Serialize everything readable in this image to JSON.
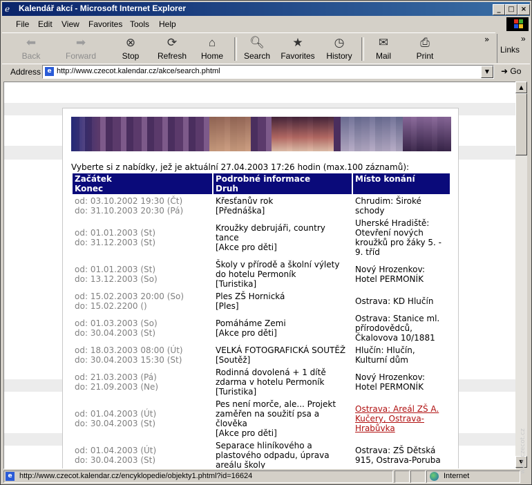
{
  "window": {
    "title": "Kalendář akcí - Microsoft Internet Explorer",
    "minimize": "_",
    "maximize": "□",
    "close": "×"
  },
  "menu": [
    "File",
    "Edit",
    "View",
    "Favorites",
    "Tools",
    "Help"
  ],
  "toolbar": {
    "buttons": [
      {
        "label": "Back",
        "icon": "back-arrow-icon",
        "enabled": false
      },
      {
        "label": "Forward",
        "icon": "forward-arrow-icon",
        "enabled": false
      },
      {
        "label": "Stop",
        "icon": "stop-icon",
        "enabled": true
      },
      {
        "label": "Refresh",
        "icon": "refresh-icon",
        "enabled": true
      },
      {
        "label": "Home",
        "icon": "home-icon",
        "enabled": true
      },
      {
        "label": "Search",
        "icon": "search-icon",
        "enabled": true
      },
      {
        "label": "Favorites",
        "icon": "favorites-icon",
        "enabled": true
      },
      {
        "label": "History",
        "icon": "history-icon",
        "enabled": true
      },
      {
        "label": "Mail",
        "icon": "mail-icon",
        "enabled": true
      },
      {
        "label": "Print",
        "icon": "print-icon",
        "enabled": true
      }
    ],
    "links_label": "Links",
    "chevron": "»"
  },
  "address": {
    "label": "Address",
    "url": "http://www.czecot.kalendar.cz/akce/search.phtml",
    "go_label": "Go"
  },
  "page": {
    "intro": "Vyberte si z nabídky, jež je aktuální 27.04.2003 17:26 hodin (max.100 záznamů):",
    "headers": {
      "col1_line1": "Začátek",
      "col1_line2": "Konec",
      "col2_line1": "Podrobné informace",
      "col2_line2": "Druh",
      "col3": "Místo konání"
    },
    "events": [
      {
        "from": "od: 03.10.2002 19:30 (Čt)",
        "to": "do: 31.10.2003 20:30 (Pá)",
        "name": "Křesťanův rok",
        "type": "[Přednáška]",
        "place": "Chrudim: Široké schody",
        "place_link": false
      },
      {
        "from": "od: 01.01.2003 (St)",
        "to": "do: 31.12.2003 (St)",
        "name": "Kroužky debrujáři, country tance",
        "type": "[Akce pro děti]",
        "place": "Uherské Hradiště: Otevření nových kroužků pro žáky 5. - 9. tříd",
        "place_link": false
      },
      {
        "from": "od: 01.01.2003 (St)",
        "to": "do: 13.12.2003 (So)",
        "name": "Školy v přírodě a školní výlety do hotelu Permoník",
        "type": "[Turistika]",
        "place": "Nový Hrozenkov: Hotel PERMONÍK",
        "place_link": false
      },
      {
        "from": "od: 15.02.2003 20:00 (So)",
        "to": "do: 15.02.2200 ()",
        "name": "Ples ZŠ Hornická",
        "type": "[Ples]",
        "place": "Ostrava: KD Hlučín",
        "place_link": false
      },
      {
        "from": "od: 01.03.2003 (So)",
        "to": "do: 30.04.2003 (St)",
        "name": "Pomáháme Zemi",
        "type": "[Akce pro děti]",
        "place": "Ostrava: Stanice ml. přírodovědců, Čkalovova 10/1881",
        "place_link": false
      },
      {
        "from": "od: 18.03.2003 08:00 (Út)",
        "to": "do: 30.04.2003 15:30 (St)",
        "name": "VELKÁ FOTOGRAFICKÁ SOUTĚŽ",
        "type": "[Soutěž]",
        "place": "Hlučín: Hlučín, Kulturní dům",
        "place_link": false
      },
      {
        "from": "od: 21.03.2003 (Pá)",
        "to": "do: 21.09.2003 (Ne)",
        "name": "Rodinná dovolená + 1 dítě zdarma v hotelu Permoník",
        "type": "[Turistika]",
        "place": "Nový Hrozenkov: Hotel PERMONÍK",
        "place_link": false
      },
      {
        "from": "od: 01.04.2003 (Út)",
        "to": "do: 30.04.2003 (St)",
        "name": "Pes není morče, ale... Projekt zaměřen na soužití psa a člověka",
        "type": "[Akce pro děti]",
        "place": "Ostrava: Areál ZŠ A. Kučery, Ostrava-Hrabůvka",
        "place_link": true
      },
      {
        "from": "od: 01.04.2003 (Út)",
        "to": "do: 30.04.2003 (St)",
        "name": "Separace hliníkového a plastového odpadu, úprava areálu školy",
        "type": "",
        "place": "Ostrava: ZŠ Dětská 915, Ostrava-Poruba",
        "place_link": false
      }
    ]
  },
  "status": {
    "text": "http://www.czecot.kalendar.cz/encyklopedie/objekty1.phtml?id=16624",
    "zone": "Internet"
  },
  "watermark": "www.czecot.cz"
}
